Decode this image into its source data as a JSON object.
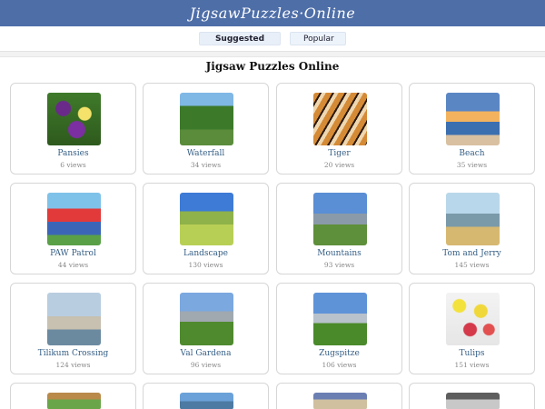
{
  "header": {
    "brand": "JigsawPuzzles·Online"
  },
  "tabs": [
    {
      "label": "Suggested",
      "active": true
    },
    {
      "label": "Popular",
      "active": false
    }
  ],
  "page": {
    "title": "Jigsaw Puzzles Online"
  },
  "puzzles": [
    {
      "name": "Pansies",
      "views": "6 views",
      "thumb": "pansies"
    },
    {
      "name": "Waterfall",
      "views": "34 views",
      "thumb": "waterfall"
    },
    {
      "name": "Tiger",
      "views": "20 views",
      "thumb": "tiger"
    },
    {
      "name": "Beach",
      "views": "35 views",
      "thumb": "beach"
    },
    {
      "name": "PAW Patrol",
      "views": "44 views",
      "thumb": "paw"
    },
    {
      "name": "Landscape",
      "views": "130 views",
      "thumb": "landscape"
    },
    {
      "name": "Mountains",
      "views": "93 views",
      "thumb": "mountains"
    },
    {
      "name": "Tom and Jerry",
      "views": "145 views",
      "thumb": "tom"
    },
    {
      "name": "Tilikum Crossing",
      "views": "124 views",
      "thumb": "tilikum"
    },
    {
      "name": "Val Gardena",
      "views": "96 views",
      "thumb": "val"
    },
    {
      "name": "Zugspitze",
      "views": "106 views",
      "thumb": "zug"
    },
    {
      "name": "Tulips",
      "views": "151 views",
      "thumb": "tulips"
    }
  ]
}
